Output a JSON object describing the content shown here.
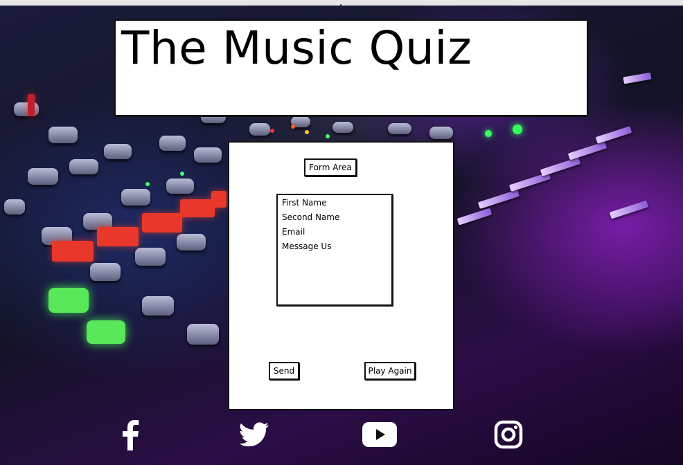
{
  "header": {
    "title": "The Music Quiz"
  },
  "form": {
    "area_label": "Form Area",
    "fields": [
      {
        "label": "First Name"
      },
      {
        "label": "Second Name"
      },
      {
        "label": "Email"
      },
      {
        "label": "Message Us"
      }
    ],
    "send_label": "Send",
    "play_again_label": "Play Again"
  },
  "social": [
    {
      "icon": "facebook-icon"
    },
    {
      "icon": "twitter-icon"
    },
    {
      "icon": "youtube-icon"
    },
    {
      "icon": "instagram-icon"
    }
  ],
  "colors": {
    "panel": "#ffffff",
    "outline": "#111111",
    "icon": "#ffffff",
    "accent_purple": "#9b2cf2"
  }
}
